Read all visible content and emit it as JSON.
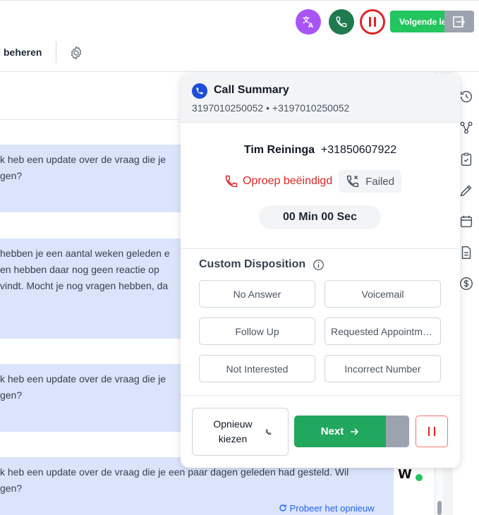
{
  "topbar": {
    "translate_icon": "translate-icon",
    "next_lead_label": "Volgende lead"
  },
  "toolbar": {
    "manage_label": "beheren"
  },
  "conversation": {
    "messages": [
      {
        "lines": [
          "k heb een update over de vraag die je",
          "gen?"
        ]
      },
      {
        "lines": [
          "hebben je een aantal weken geleden e",
          " en hebben daar nog geen reactie op",
          "vindt. Mocht je nog vragen hebben, da"
        ]
      },
      {
        "lines": [
          "k heb een update over de vraag die je",
          "gen?"
        ]
      },
      {
        "lines": [
          "k heb een update over de vraag die je een paar dagen geleden had gesteld. Wil",
          "gen?"
        ]
      }
    ],
    "retry_label": "Probeer het opnieuw"
  },
  "call_summary": {
    "title": "Call Summary",
    "subtitle": "3197010250052 • +3197010250052",
    "contact_name": "Tim Reininga",
    "contact_phone": "+31850607922",
    "status": "Oproep beëindigd",
    "result": "Failed",
    "duration": "00 Min 00 Sec",
    "disposition_title": "Custom Disposition",
    "dispositions": [
      "No Answer",
      "Voicemail",
      "Follow Up",
      "Requested Appointment",
      "Not Interested",
      "Incorrect Number"
    ],
    "redial_label": "Opnieuw kiezen",
    "next_label": "Next"
  },
  "colors": {
    "accent_green": "#22a75e",
    "danger_red": "#dc2626",
    "brand_blue": "#1d4ed8",
    "translate_purple": "#a855f7"
  }
}
